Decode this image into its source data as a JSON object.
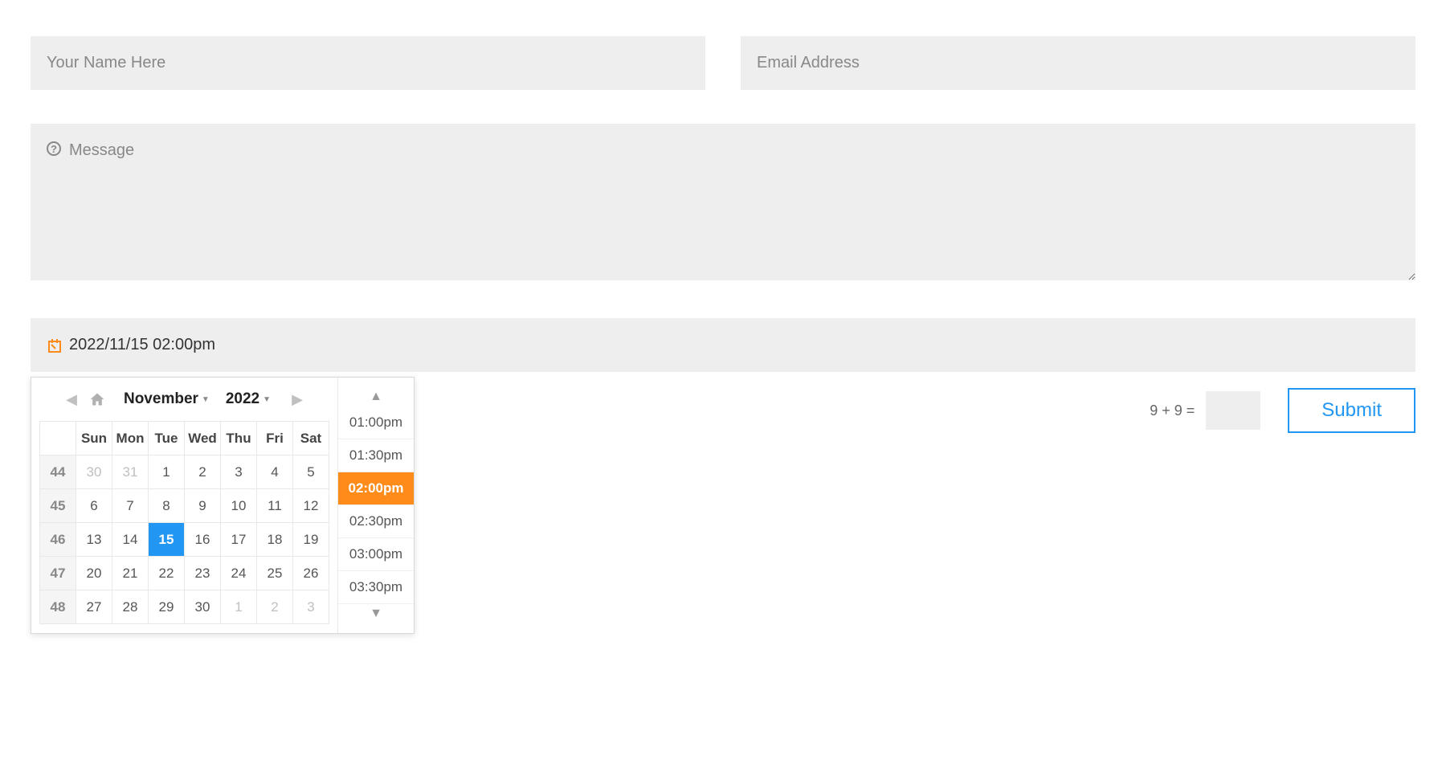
{
  "form": {
    "name_placeholder": "Your Name Here",
    "name_value": "",
    "email_placeholder": "Email Address",
    "email_value": "",
    "message_placeholder": "Message",
    "message_value": "",
    "datetime_value": "2022/11/15 02:00pm"
  },
  "calendar": {
    "month_label": "November",
    "year_label": "2022",
    "weekdays": [
      "Sun",
      "Mon",
      "Tue",
      "Wed",
      "Thu",
      "Fri",
      "Sat"
    ],
    "weeks": [
      {
        "num": "44",
        "days": [
          {
            "d": "30",
            "other": true
          },
          {
            "d": "31",
            "other": true
          },
          {
            "d": "1"
          },
          {
            "d": "2"
          },
          {
            "d": "3"
          },
          {
            "d": "4"
          },
          {
            "d": "5"
          }
        ]
      },
      {
        "num": "45",
        "days": [
          {
            "d": "6"
          },
          {
            "d": "7"
          },
          {
            "d": "8"
          },
          {
            "d": "9"
          },
          {
            "d": "10"
          },
          {
            "d": "11"
          },
          {
            "d": "12"
          }
        ]
      },
      {
        "num": "46",
        "days": [
          {
            "d": "13"
          },
          {
            "d": "14"
          },
          {
            "d": "15",
            "selected": true
          },
          {
            "d": "16"
          },
          {
            "d": "17"
          },
          {
            "d": "18"
          },
          {
            "d": "19"
          }
        ]
      },
      {
        "num": "47",
        "days": [
          {
            "d": "20"
          },
          {
            "d": "21"
          },
          {
            "d": "22"
          },
          {
            "d": "23"
          },
          {
            "d": "24"
          },
          {
            "d": "25"
          },
          {
            "d": "26"
          }
        ]
      },
      {
        "num": "48",
        "days": [
          {
            "d": "27"
          },
          {
            "d": "28"
          },
          {
            "d": "29"
          },
          {
            "d": "30"
          },
          {
            "d": "1",
            "other": true
          },
          {
            "d": "2",
            "other": true
          },
          {
            "d": "3",
            "other": true
          }
        ]
      }
    ],
    "times": [
      {
        "t": "01:00pm"
      },
      {
        "t": "01:30pm"
      },
      {
        "t": "02:00pm",
        "selected": true
      },
      {
        "t": "02:30pm"
      },
      {
        "t": "03:00pm"
      },
      {
        "t": "03:30pm"
      }
    ]
  },
  "captcha": {
    "question": "9 + 9 ="
  },
  "submit_label": "Submit"
}
